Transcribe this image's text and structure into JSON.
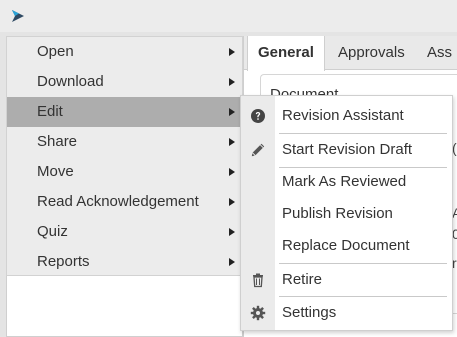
{
  "header": {
    "logo_icon": "app-logo-icon"
  },
  "tabs": [
    {
      "label": "General",
      "active": true
    },
    {
      "label": "Approvals",
      "active": false
    },
    {
      "label": "Ass",
      "active": false
    }
  ],
  "document": {
    "heading": "Document"
  },
  "right_fragments": [
    "(",
    "A",
    "0",
    "r"
  ],
  "context_menu": {
    "items": [
      {
        "label": "Open",
        "has_submenu": true,
        "highlighted": false
      },
      {
        "label": "Download",
        "has_submenu": true,
        "highlighted": false
      },
      {
        "label": "Edit",
        "has_submenu": true,
        "highlighted": true
      },
      {
        "label": "Share",
        "has_submenu": true,
        "highlighted": false
      },
      {
        "label": "Move",
        "has_submenu": true,
        "highlighted": false
      },
      {
        "label": "Read Acknowledgement",
        "has_submenu": true,
        "highlighted": false
      },
      {
        "label": "Quiz",
        "has_submenu": true,
        "highlighted": false
      },
      {
        "label": "Reports",
        "has_submenu": true,
        "highlighted": false
      }
    ]
  },
  "edit_submenu": {
    "items": [
      {
        "label": "Revision Assistant",
        "icon": "question-circle-icon"
      },
      {
        "label": "Start Revision Draft",
        "icon": "pencil-icon"
      },
      {
        "label": "Mark As Reviewed",
        "icon": ""
      },
      {
        "label": "Publish Revision",
        "icon": ""
      },
      {
        "label": "Replace Document",
        "icon": ""
      },
      {
        "label": "Retire",
        "icon": "trash-icon"
      },
      {
        "label": "Settings",
        "icon": "gear-icon"
      }
    ]
  },
  "colors": {
    "menu_background": "#ececec",
    "highlight": "#adadad",
    "text": "#333333"
  }
}
